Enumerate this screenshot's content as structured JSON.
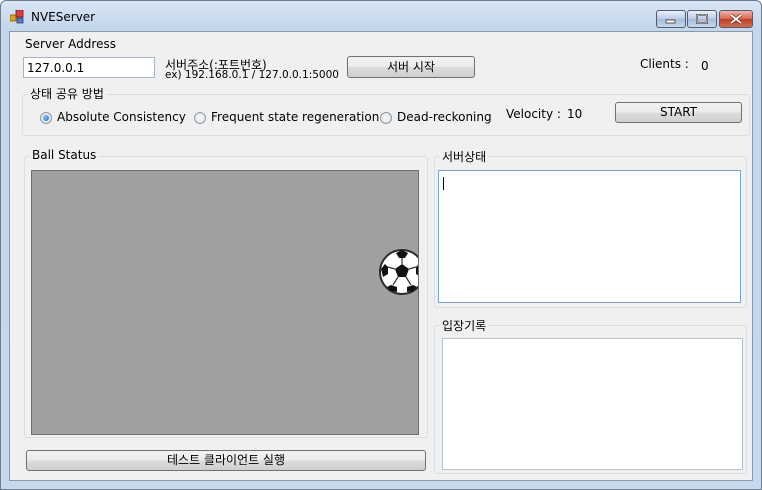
{
  "window": {
    "title": "NVEServer"
  },
  "server": {
    "label": "Server Address",
    "address_value": "127.0.0.1",
    "hint_line1": "서버주소(:포트번호)",
    "hint_line2": "ex) 192.168.0.1 / 127.0.0.1:5000",
    "start_button": "서버 시작",
    "clients_label": "Clients :",
    "clients_count": "0"
  },
  "sync": {
    "group_title": "상태 공유 방법",
    "options": [
      {
        "label": "Absolute Consistency",
        "checked": true
      },
      {
        "label": "Frequent state regeneration",
        "checked": false
      },
      {
        "label": "Dead-reckoning",
        "checked": false
      }
    ],
    "velocity_label": "Velocity :",
    "velocity_value": "10",
    "start_button": "START"
  },
  "ball_status": {
    "group_title": "Ball Status",
    "canvas_color": "#a0a0a0",
    "ball_icon": "soccer-ball-icon"
  },
  "server_status": {
    "group_title": "서버상태",
    "log_text": ""
  },
  "entry_log": {
    "group_title": "입장기록",
    "log_text": ""
  },
  "test_client_button": "테스트 클라이언트 실행"
}
